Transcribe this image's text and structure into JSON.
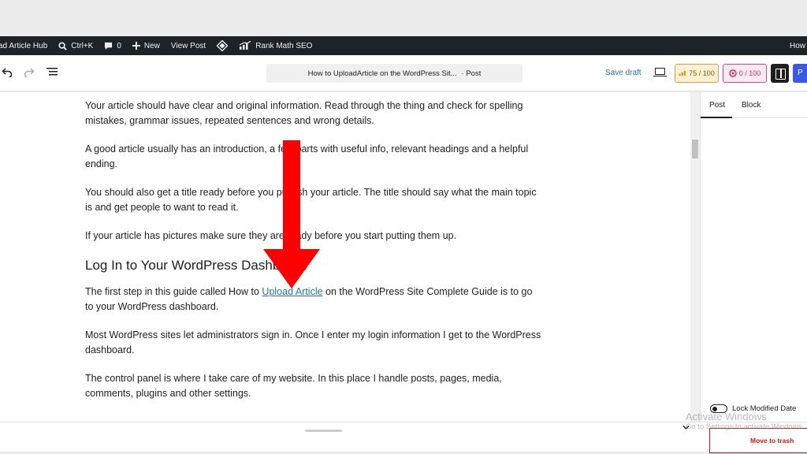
{
  "admin_bar": {
    "site_name": "ad Article Hub",
    "search_shortcut": "Ctrl+K",
    "comments_count": "0",
    "new_label": "New",
    "view_post_label": "View Post",
    "rank_math_label": "Rank Math SEO",
    "right_label": "How"
  },
  "toolbar": {
    "document_title": "How to UploadArticle on the WordPress Sit...",
    "document_type": "· Post",
    "save_draft_label": "Save draft",
    "seo_score": "75 / 100",
    "readability_score": "0 / 100",
    "publish_label": "P"
  },
  "content": {
    "paragraphs_top": [
      "Your article should have clear and original information. Read through the thing and check for spelling mistakes, grammar issues, repeated sentences and wrong details.",
      "A good article usually has an introduction, a few parts with useful info, relevant headings and a helpful ending.",
      "You should also get a title ready before you publish your article. The title should say what the main topic is and get people to want to read it.",
      "If your article has pictures make sure they are ready before you start putting them up."
    ],
    "heading": "Log In to Your WordPress Dashboard",
    "link_paragraph": {
      "before": "The first step in this guide called How to ",
      "link": "Upload Article",
      "after": " on the WordPress Site Complete Guide is to go to your WordPress dashboard."
    },
    "paragraphs_bottom": [
      "Most WordPress sites let administrators sign in. Once I enter my login information I get to the WordPress dashboard.",
      "The control panel is where I take care of my website. In this place I handle posts, pages, media, comments, plugins and other settings."
    ]
  },
  "sidebar": {
    "tab_post": "Post",
    "tab_block": "Block",
    "lock_modified_label": "Lock Modified Date"
  },
  "bottom_bar": {
    "move_to_trash": "Move to trash"
  },
  "watermark": {
    "title": "Activate Windows",
    "subtitle": "Go to Settings to activate Windows."
  },
  "colors": {
    "admin_bar_bg": "#1d2327",
    "link": "#2271b1",
    "arrow": "#ff0000",
    "seo_score_accent": "#e0a040",
    "readability_accent": "#e0457b",
    "publish": "#3858e9",
    "trash": "#cc1818"
  },
  "icons": [
    "search-icon",
    "comment-icon",
    "plus-icon",
    "diamond-icon",
    "rank-math-icon",
    "undo-icon",
    "redo-icon",
    "list-view-icon",
    "preview-icon",
    "settings-panel-icon",
    "chevron-down-icon"
  ]
}
